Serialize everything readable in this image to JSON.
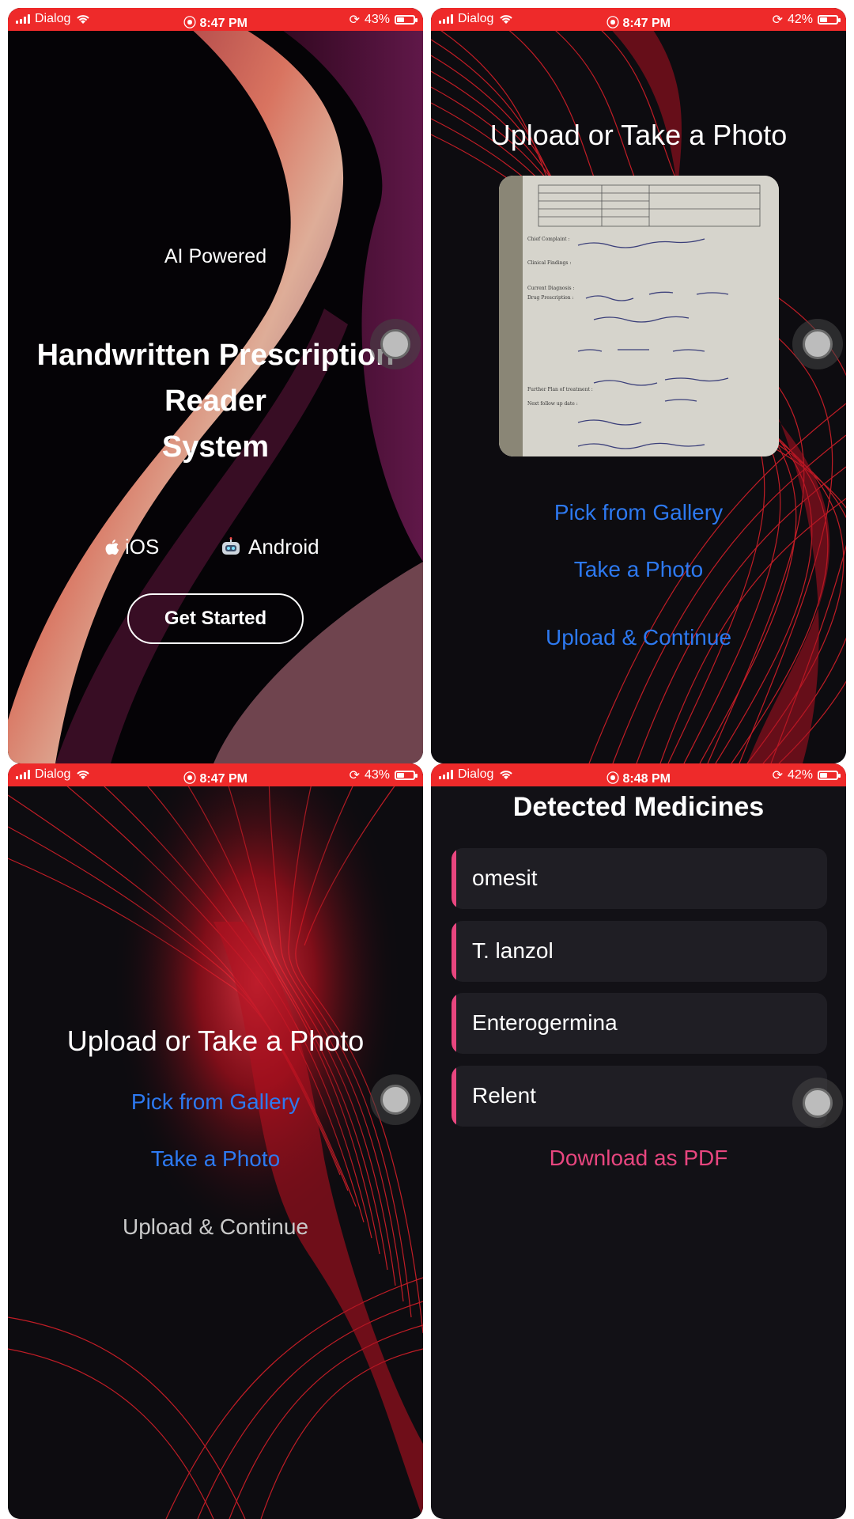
{
  "status_bars": [
    {
      "carrier": "Dialog",
      "time": "8:47 PM",
      "battery": "43%"
    },
    {
      "carrier": "Dialog",
      "time": "8:47 PM",
      "battery": "42%"
    },
    {
      "carrier": "Dialog",
      "time": "8:47 PM",
      "battery": "43%"
    },
    {
      "carrier": "Dialog",
      "time": "8:48 PM",
      "battery": "42%"
    }
  ],
  "welcome": {
    "tagline": "AI Powered",
    "title_line1": "Handwritten Prescription",
    "title_line2": "Reader",
    "title_line3": "System",
    "platform_ios": "iOS",
    "platform_android": "Android",
    "get_started": "Get Started"
  },
  "upload_with_photo": {
    "heading": "Upload or Take a Photo",
    "pick_gallery": "Pick from Gallery",
    "take_photo": "Take a Photo",
    "upload_continue": "Upload & Continue"
  },
  "upload_empty": {
    "heading": "Upload or Take a Photo",
    "pick_gallery": "Pick from Gallery",
    "take_photo": "Take a Photo",
    "upload_continue": "Upload & Continue"
  },
  "results": {
    "heading": "Detected Medicines",
    "medicines": [
      "omesit",
      "T. lanzol",
      "Enterogermina",
      "Relent"
    ],
    "download": "Download as PDF"
  },
  "colors": {
    "status_bar": "#ee2a2a",
    "link_blue": "#2d79f0",
    "accent_pink": "#e8467f",
    "card_bg": "#1f1e24"
  }
}
